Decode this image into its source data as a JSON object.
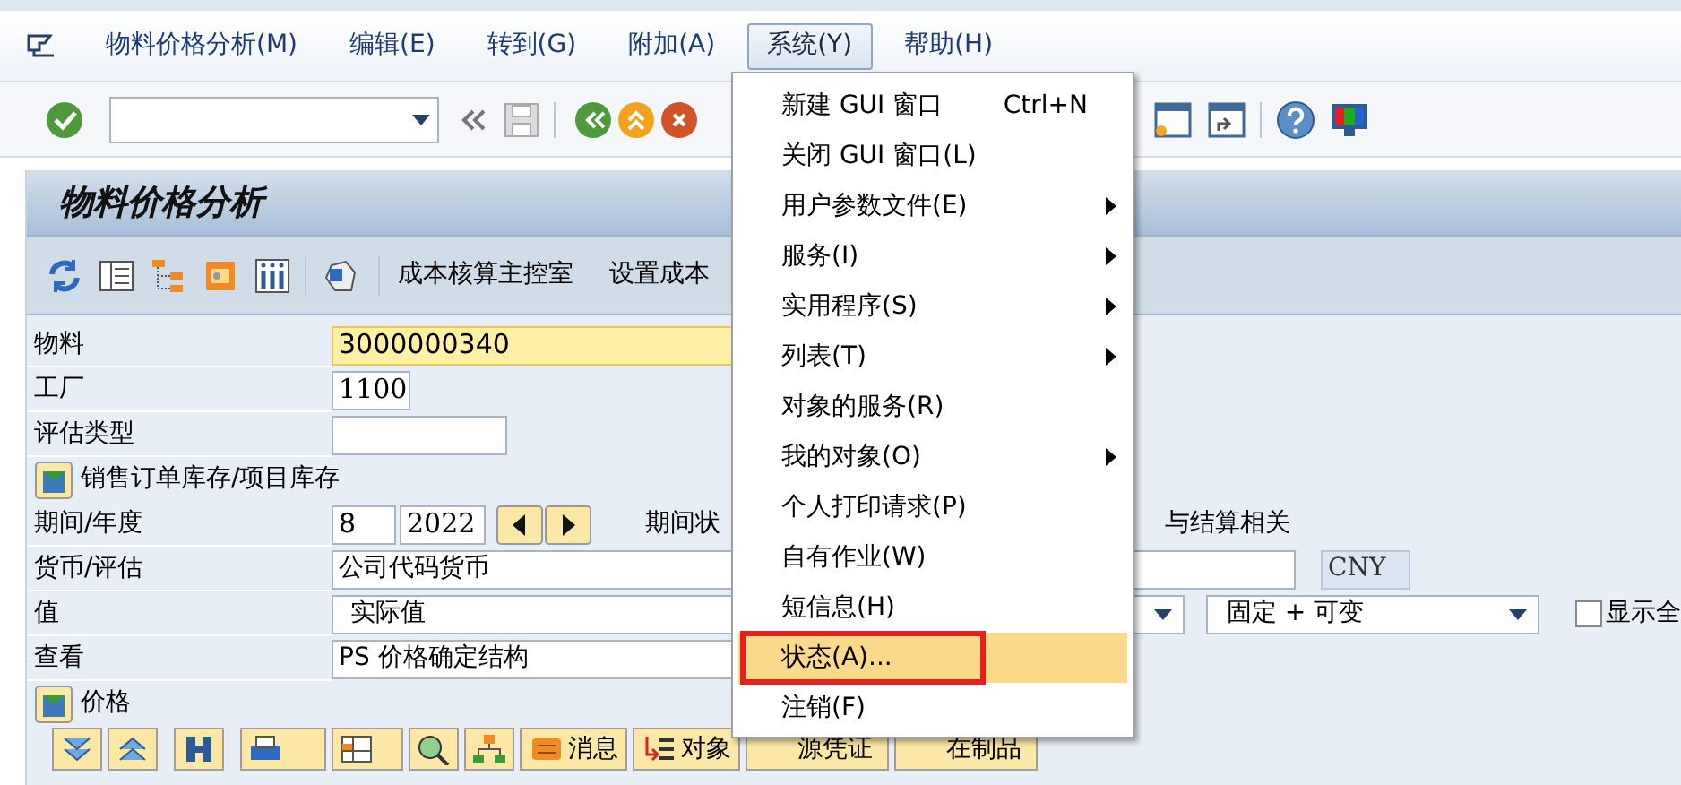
{
  "menubar": {
    "items": [
      {
        "label": "物料价格分析(M)",
        "selected": false
      },
      {
        "label": "编辑(E)",
        "selected": false
      },
      {
        "label": "转到(G)",
        "selected": false
      },
      {
        "label": "附加(A)",
        "selected": false
      },
      {
        "label": "系统(Y)",
        "selected": true
      },
      {
        "label": "帮助(H)",
        "selected": false
      }
    ]
  },
  "menu": {
    "items": [
      {
        "label": "新建 GUI 窗口",
        "shortcut": "Ctrl+N",
        "submenu": false,
        "selected": false,
        "marked": false
      },
      {
        "label": "关闭 GUI 窗口(L)",
        "submenu": false,
        "selected": false,
        "marked": false
      },
      {
        "label": "用户参数文件(E)",
        "submenu": true,
        "selected": false,
        "marked": false
      },
      {
        "label": "服务(I)",
        "submenu": true,
        "selected": false,
        "marked": false
      },
      {
        "label": "实用程序(S)",
        "submenu": true,
        "selected": false,
        "marked": false
      },
      {
        "label": "列表(T)",
        "submenu": true,
        "selected": false,
        "marked": false
      },
      {
        "label": "对象的服务(R)",
        "submenu": false,
        "selected": false,
        "marked": false
      },
      {
        "label": "我的对象(O)",
        "submenu": true,
        "selected": false,
        "marked": false
      },
      {
        "label": "个人打印请求(P)",
        "submenu": false,
        "selected": false,
        "marked": false
      },
      {
        "label": "自有作业(W)",
        "submenu": false,
        "selected": false,
        "marked": false
      },
      {
        "label": "短信息(H)",
        "submenu": false,
        "selected": false,
        "marked": false
      },
      {
        "label": "状态(A)...",
        "submenu": false,
        "selected": true,
        "marked": true
      },
      {
        "label": "注销(F)",
        "submenu": false,
        "selected": false,
        "marked": false
      }
    ]
  },
  "title": "物料价格分析",
  "app_toolbar": {
    "buttons": [
      "成本核算主控室",
      "设置成本"
    ]
  },
  "form": {
    "material": {
      "label": "物料",
      "value": "3000000340"
    },
    "plant": {
      "label": "工厂",
      "value": "1100"
    },
    "valuation_type": {
      "label": "评估类型"
    },
    "sales_order_stock": {
      "label": "销售订单库存/项目库存"
    },
    "period": {
      "label": "期间/年度",
      "period": "8",
      "year": "2022",
      "status_label": "期间状",
      "settlement_label": "与结算相关"
    },
    "currency": {
      "label": "货币/评估",
      "value": "公司代码货币",
      "currency": "CNY"
    },
    "values": {
      "label": "值",
      "value": "实际值",
      "cost_split": "固定 + 可变",
      "show_all": {
        "label": "显示全",
        "checked": false
      }
    },
    "view": {
      "label": "查看",
      "value": "PS 价格确定结构"
    },
    "price": {
      "label": "价格"
    }
  },
  "bottom_toolbar": {
    "buttons": [
      "消息",
      "对象",
      "源凭证",
      "在制品"
    ]
  }
}
